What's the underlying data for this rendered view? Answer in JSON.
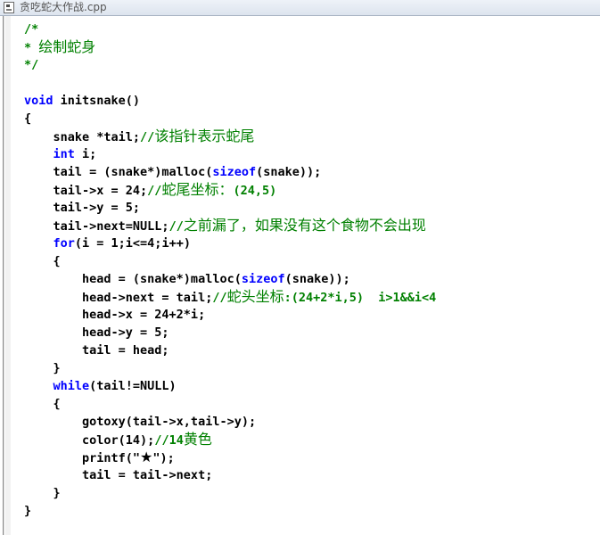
{
  "window": {
    "title": "贪吃蛇大作战.cpp"
  },
  "editor": {
    "lines": [
      [
        {
          "t": "/*",
          "k": "cmt"
        }
      ],
      [
        {
          "t": "* ",
          "k": "cmt"
        },
        {
          "t": "绘制蛇身",
          "k": "cmt cn"
        }
      ],
      [
        {
          "t": "*/",
          "k": "cmt"
        }
      ],
      [],
      [
        {
          "t": "void",
          "k": "kw"
        },
        {
          "t": " initsnake()",
          "k": ""
        }
      ],
      [
        {
          "t": "{",
          "k": ""
        }
      ],
      [
        {
          "t": "    snake *tail;",
          "k": ""
        },
        {
          "t": "//",
          "k": "cmt"
        },
        {
          "t": "该指针表示蛇尾",
          "k": "cmt cn"
        }
      ],
      [
        {
          "t": "    ",
          "k": ""
        },
        {
          "t": "int",
          "k": "kw"
        },
        {
          "t": " i;",
          "k": ""
        }
      ],
      [
        {
          "t": "    tail = (snake*)malloc(",
          "k": ""
        },
        {
          "t": "sizeof",
          "k": "kw"
        },
        {
          "t": "(snake));",
          "k": ""
        }
      ],
      [
        {
          "t": "    tail->x = 24;",
          "k": ""
        },
        {
          "t": "//",
          "k": "cmt"
        },
        {
          "t": "蛇尾坐标：",
          "k": "cmt cn"
        },
        {
          "t": "(24,5)",
          "k": "cmt"
        }
      ],
      [
        {
          "t": "    tail->y = 5;",
          "k": ""
        }
      ],
      [
        {
          "t": "    tail->next=NULL;",
          "k": ""
        },
        {
          "t": "//",
          "k": "cmt"
        },
        {
          "t": "之前漏了，如果没有这个食物不会出现",
          "k": "cmt cn"
        }
      ],
      [
        {
          "t": "    ",
          "k": ""
        },
        {
          "t": "for",
          "k": "kw"
        },
        {
          "t": "(i = 1;i<=4;i++)",
          "k": ""
        }
      ],
      [
        {
          "t": "    {",
          "k": ""
        }
      ],
      [
        {
          "t": "        head = (snake*)malloc(",
          "k": ""
        },
        {
          "t": "sizeof",
          "k": "kw"
        },
        {
          "t": "(snake));",
          "k": ""
        }
      ],
      [
        {
          "t": "        head->next = tail;",
          "k": ""
        },
        {
          "t": "//",
          "k": "cmt"
        },
        {
          "t": "蛇头坐标",
          "k": "cmt cn"
        },
        {
          "t": ":(24+2*i,5)  i>1&&i<4",
          "k": "cmt"
        }
      ],
      [
        {
          "t": "        head->x = 24+2*i;",
          "k": ""
        }
      ],
      [
        {
          "t": "        head->y = 5;",
          "k": ""
        }
      ],
      [
        {
          "t": "        tail = head;",
          "k": ""
        }
      ],
      [
        {
          "t": "    }",
          "k": ""
        }
      ],
      [
        {
          "t": "    ",
          "k": ""
        },
        {
          "t": "while",
          "k": "kw"
        },
        {
          "t": "(tail!=NULL)",
          "k": ""
        }
      ],
      [
        {
          "t": "    {",
          "k": ""
        }
      ],
      [
        {
          "t": "        gotoxy(tail->x,tail->y);",
          "k": ""
        }
      ],
      [
        {
          "t": "        color(14);",
          "k": ""
        },
        {
          "t": "//14",
          "k": "cmt"
        },
        {
          "t": "黄色",
          "k": "cmt cn"
        }
      ],
      [
        {
          "t": "        printf(\"",
          "k": ""
        },
        {
          "t": "★",
          "k": "cn"
        },
        {
          "t": "\");",
          "k": ""
        }
      ],
      [
        {
          "t": "        tail = tail->next;",
          "k": ""
        }
      ],
      [
        {
          "t": "    }",
          "k": ""
        }
      ],
      [
        {
          "t": "}",
          "k": ""
        }
      ]
    ]
  },
  "colors": {
    "keyword": "#0000ff",
    "comment": "#008000",
    "text": "#000000",
    "background": "#ffffff"
  },
  "icons": {
    "title": "file-icon"
  }
}
